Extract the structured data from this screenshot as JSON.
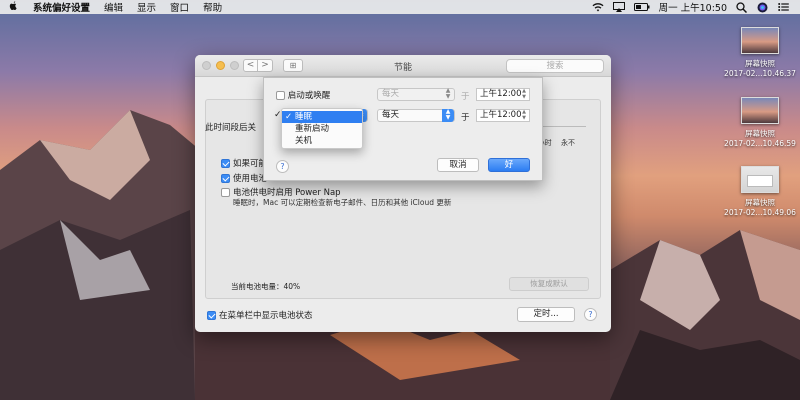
{
  "menubar": {
    "apple": "",
    "items": [
      "系统偏好设置",
      "编辑",
      "显示",
      "窗口",
      "帮助"
    ],
    "clock": "周一 上午10:50"
  },
  "desktop_icons": [
    {
      "label1": "屏幕快照",
      "label2": "2017-02...10.46.37"
    },
    {
      "label1": "屏幕快照",
      "label2": "2017-02...10.46.59"
    },
    {
      "label1": "屏幕快照",
      "label2": "2017-02...10.49.06"
    }
  ],
  "window": {
    "title": "节能",
    "search_placeholder": "搜索",
    "nav_back": "<",
    "nav_forward": ">",
    "grid": "⊞",
    "timeoff_label": "此时间段后关",
    "slider_labels": [
      "3 小时",
      "永不"
    ],
    "options": [
      "如果可能",
      "使用电池",
      "电池供电时启用 Power Nap"
    ],
    "option_desc": "睡眠时，Mac 可以定期检查新电子邮件、日历和其他 iCloud 更新",
    "battery_level": "当前电池电量：40%",
    "restore_button": "恢复成默认",
    "show_battery_status": "在菜单栏中显示电池状态",
    "schedule_button": "定时...",
    "help": "?"
  },
  "sheet": {
    "row1": {
      "label": "启动或唤醒",
      "day": "每天",
      "at": "于",
      "time": "上午12:00"
    },
    "row2": {
      "day": "每天",
      "at": "于",
      "time": "上午12:00"
    },
    "help": "?",
    "cancel": "取消",
    "ok": "好"
  },
  "dropdown": {
    "check": "✓",
    "items": [
      "睡眠",
      "重新启动",
      "关机"
    ]
  },
  "colors": {
    "accent": "#2f7ff1",
    "yellow_button": "#f5be4f"
  }
}
